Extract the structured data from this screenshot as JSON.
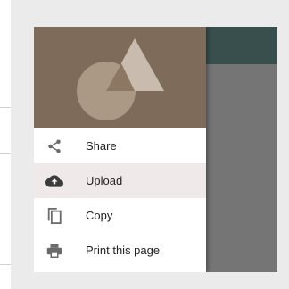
{
  "drawer": {
    "items": [
      {
        "label": "Share",
        "icon": "share-icon"
      },
      {
        "label": "Upload",
        "icon": "cloud-upload-icon",
        "selected": true
      },
      {
        "label": "Copy",
        "icon": "copy-icon"
      },
      {
        "label": "Print this page",
        "icon": "print-icon"
      }
    ]
  },
  "colors": {
    "appbar": "#384f4d",
    "scrim": "#757575",
    "header": "#7f6b59",
    "selected_item": "#efe9e9"
  }
}
